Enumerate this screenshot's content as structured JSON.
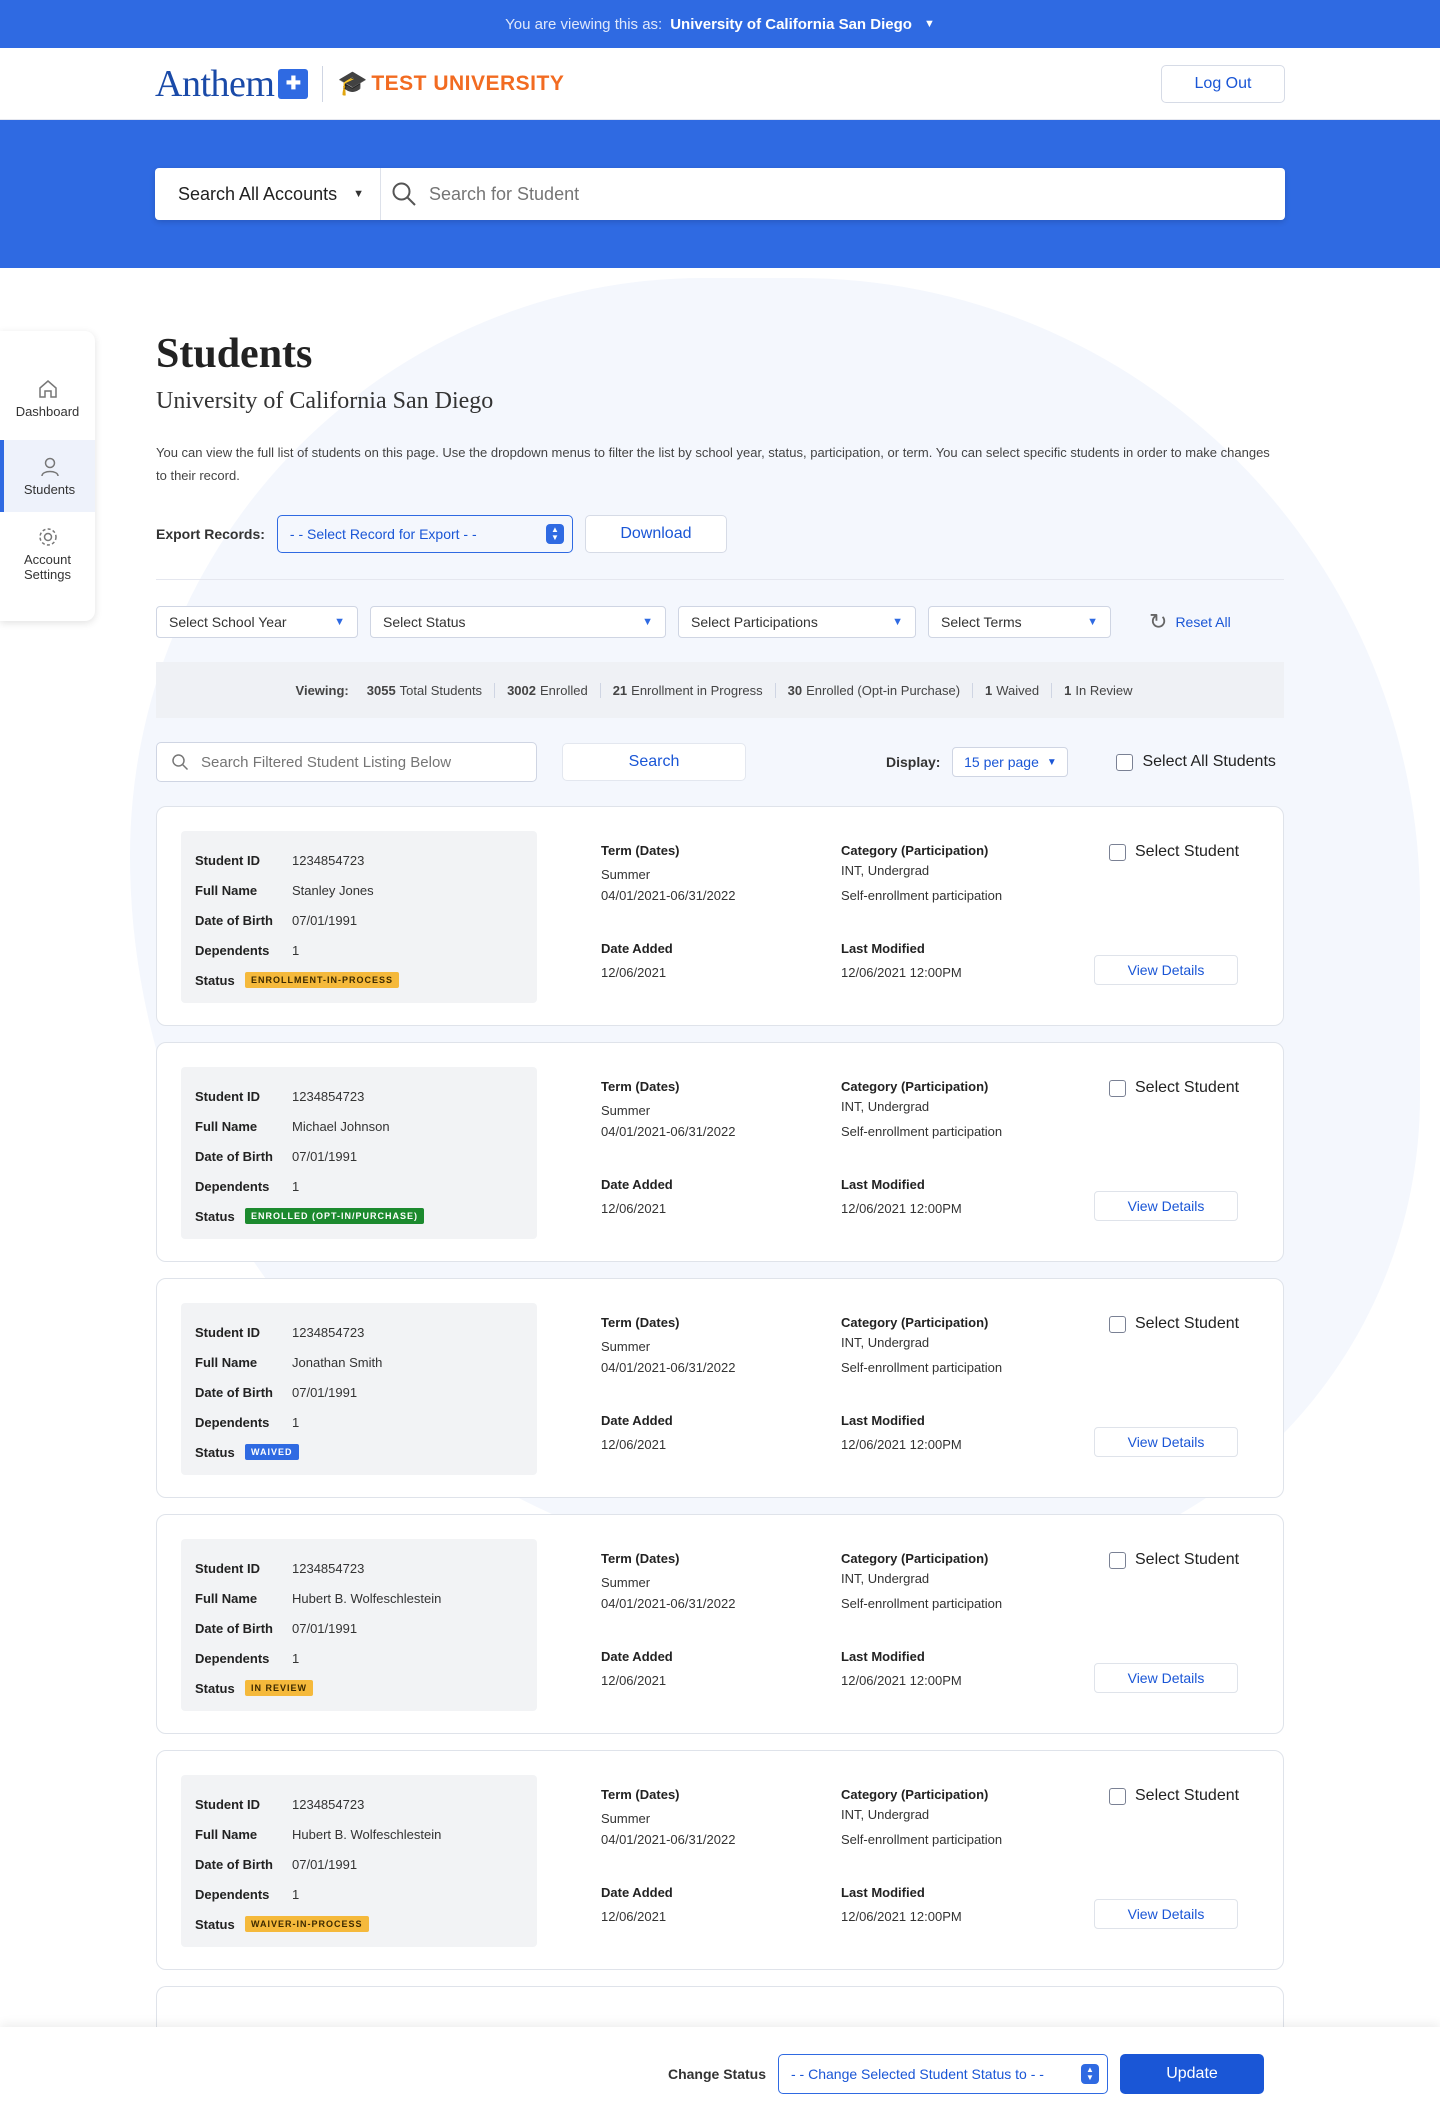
{
  "topbar": {
    "prefix": "You are viewing this as:",
    "org": "University of California San Diego"
  },
  "header": {
    "brand": "Anthem",
    "bcbs_mark": "✚",
    "university": "TEST UNIVERSITY",
    "logout": "Log Out"
  },
  "search": {
    "accounts": "Search All Accounts",
    "placeholder": "Search for Student"
  },
  "sidebar": {
    "items": [
      {
        "label": "Dashboard"
      },
      {
        "label": "Students"
      },
      {
        "label": "Account Settings"
      }
    ]
  },
  "page": {
    "title": "Students",
    "subtitle": "University of California San Diego",
    "description": "You can view the full list of students on this page. Use the dropdown menus to filter the list by school year, status, participation, or term. You can select specific students in order to make changes to their record."
  },
  "export": {
    "label": "Export Records:",
    "select": "- - Select Record for Export - -",
    "download": "Download"
  },
  "filters": {
    "year": "Select School Year",
    "status": "Select Status",
    "participation": "Select Participations",
    "terms": "Select Terms",
    "reset": "Reset All"
  },
  "stats": {
    "viewing": "Viewing:",
    "items": [
      {
        "n": "3055",
        "t": "Total Students"
      },
      {
        "n": "3002",
        "t": "Enrolled"
      },
      {
        "n": "21",
        "t": "Enrollment in Progress"
      },
      {
        "n": "30",
        "t": "Enrolled (Opt-in Purchase)"
      },
      {
        "n": "1",
        "t": "Waived"
      },
      {
        "n": "1",
        "t": "In Review"
      }
    ]
  },
  "list": {
    "search_placeholder": "Search Filtered Student Listing Below",
    "search_btn": "Search",
    "display_label": "Display:",
    "per_page": "15 per page",
    "select_all": "Select All Students"
  },
  "labels": {
    "student_id": "Student ID",
    "full_name": "Full Name",
    "dob": "Date of Birth",
    "dependents": "Dependents",
    "status": "Status",
    "term": "Term (Dates)",
    "category": "Category (Participation)",
    "date_added": "Date Added",
    "last_modified": "Last Modified",
    "select_student": "Select Student",
    "view_details": "View Details"
  },
  "students": [
    {
      "id": "1234854723",
      "name": "Stanley Jones",
      "dob": "07/01/1991",
      "dependents": "1",
      "status": "ENROLLMENT-IN-PROCESS",
      "status_color": "#f5b93b",
      "term": "Summer",
      "dates": "04/01/2021-06/31/2022",
      "category": "INT, Undergrad",
      "participation": "Self-enrollment participation",
      "added": "12/06/2021",
      "modified": "12/06/2021 12:00PM"
    },
    {
      "id": "1234854723",
      "name": "Michael Johnson",
      "dob": "07/01/1991",
      "dependents": "1",
      "status": "ENROLLED (OPT-IN/PURCHASE)",
      "status_color": "#1c8a2e",
      "term": "Summer",
      "dates": "04/01/2021-06/31/2022",
      "category": "INT, Undergrad",
      "participation": "Self-enrollment participation",
      "added": "12/06/2021",
      "modified": "12/06/2021 12:00PM"
    },
    {
      "id": "1234854723",
      "name": "Jonathan Smith",
      "dob": "07/01/1991",
      "dependents": "1",
      "status": "WAIVED",
      "status_color": "#2f6ae2",
      "term": "Summer",
      "dates": "04/01/2021-06/31/2022",
      "category": "INT, Undergrad",
      "participation": "Self-enrollment participation",
      "added": "12/06/2021",
      "modified": "12/06/2021 12:00PM"
    },
    {
      "id": "1234854723",
      "name": "Hubert B. Wolfeschlestein",
      "dob": "07/01/1991",
      "dependents": "1",
      "status": "IN REVIEW",
      "status_color": "#f5b93b",
      "term": "Summer",
      "dates": "04/01/2021-06/31/2022",
      "category": "INT, Undergrad",
      "participation": "Self-enrollment participation",
      "added": "12/06/2021",
      "modified": "12/06/2021 12:00PM"
    },
    {
      "id": "1234854723",
      "name": "Hubert B. Wolfeschlestein",
      "dob": "07/01/1991",
      "dependents": "1",
      "status": "WAIVER-IN-PROCESS",
      "status_color": "#f5b93b",
      "term": "Summer",
      "dates": "04/01/2021-06/31/2022",
      "category": "INT, Undergrad",
      "participation": "Self-enrollment participation",
      "added": "12/06/2021",
      "modified": "12/06/2021 12:00PM"
    }
  ],
  "footer": {
    "label": "Change Status",
    "select": "- - Change Selected Student Status to - -",
    "update": "Update"
  }
}
